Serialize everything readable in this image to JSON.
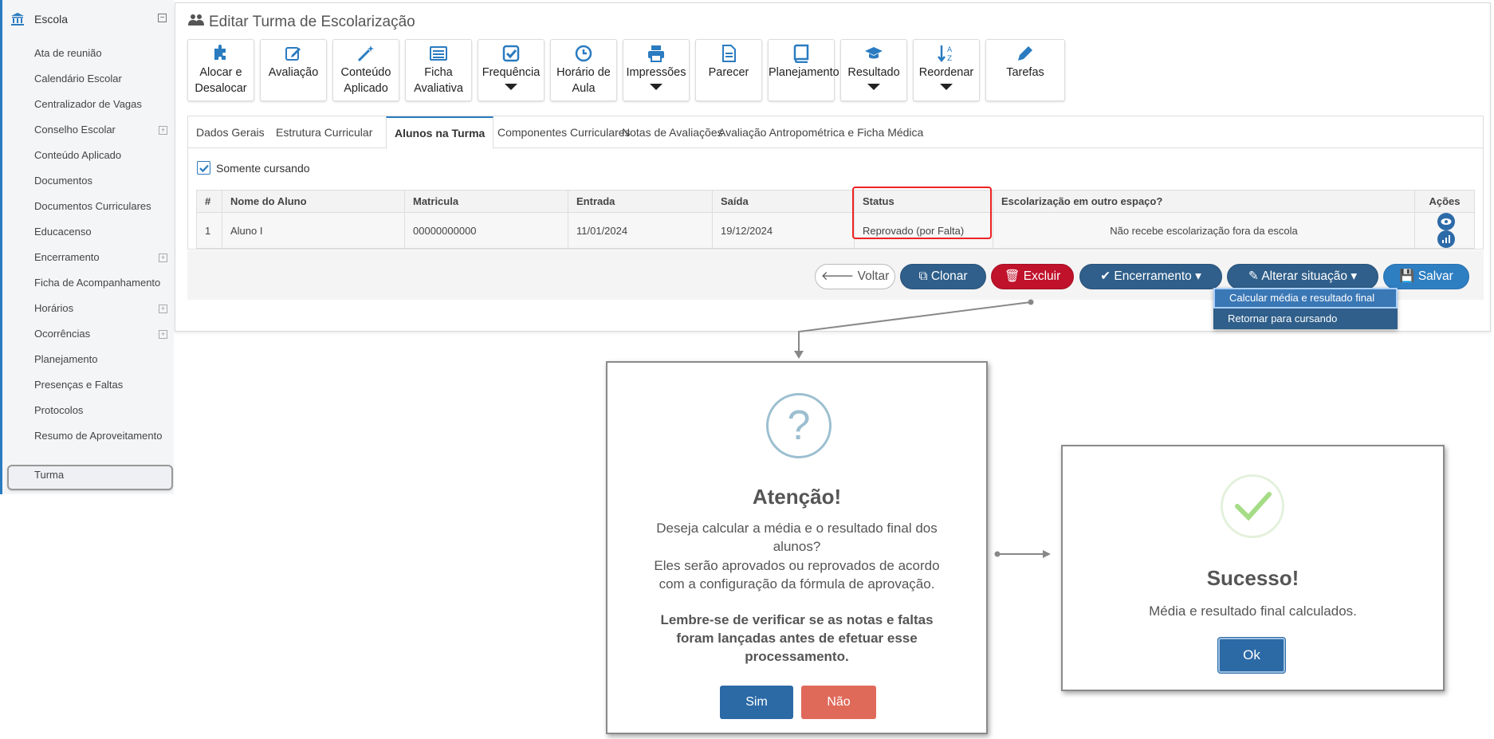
{
  "sidebar": {
    "root_label": "Escola",
    "toggle": "−",
    "items": [
      {
        "label": "Ata de reunião",
        "expandable": false
      },
      {
        "label": "Calendário Escolar",
        "expandable": false
      },
      {
        "label": "Centralizador de Vagas",
        "expandable": false
      },
      {
        "label": "Conselho Escolar",
        "expandable": true
      },
      {
        "label": "Conteúdo Aplicado",
        "expandable": false
      },
      {
        "label": "Documentos",
        "expandable": false
      },
      {
        "label": "Documentos Curriculares",
        "expandable": false
      },
      {
        "label": "Educacenso",
        "expandable": false
      },
      {
        "label": "Encerramento",
        "expandable": true
      },
      {
        "label": "Ficha de Acompanhamento",
        "expandable": false
      },
      {
        "label": "Horários",
        "expandable": true
      },
      {
        "label": "Ocorrências",
        "expandable": true
      },
      {
        "label": "Planejamento",
        "expandable": false
      },
      {
        "label": "Presenças e Faltas",
        "expandable": false
      },
      {
        "label": "Protocolos",
        "expandable": false
      },
      {
        "label": "Resumo de Aproveitamento",
        "expandable": false
      },
      {
        "label": "Turma",
        "expandable": false,
        "active": true
      }
    ],
    "plus": "+"
  },
  "page": {
    "title": "Editar Turma de Escolarização"
  },
  "toolbar": [
    {
      "label": "Alocar e\nDesalocar",
      "icon": "puzzle-icon"
    },
    {
      "label": "Avaliação",
      "icon": "edit-icon"
    },
    {
      "label": "Conteúdo\nAplicado",
      "icon": "magic-wand-icon"
    },
    {
      "label": "Ficha\nAvaliativa",
      "icon": "list-icon"
    },
    {
      "label": "Frequência",
      "icon": "checkbox-icon",
      "caret": true
    },
    {
      "label": "Horário de\nAula",
      "icon": "clock-icon"
    },
    {
      "label": "Impressões",
      "icon": "printer-icon",
      "caret": true
    },
    {
      "label": "Parecer",
      "icon": "document-icon"
    },
    {
      "label": "Planejamento",
      "icon": "book-icon"
    },
    {
      "label": "Resultado",
      "icon": "graduation-cap-icon",
      "caret": true
    },
    {
      "label": "Reordenar",
      "icon": "sort-alpha-icon",
      "caret": true
    },
    {
      "label": "Tarefas",
      "icon": "pencil-icon"
    }
  ],
  "tabs": [
    "Dados Gerais",
    "Estrutura Curricular",
    "Alunos na Turma",
    "Componentes Curriculares",
    "Notas de Avaliações",
    "Avaliação Antropométrica e Ficha Médica"
  ],
  "active_tab": "Alunos na Turma",
  "filter": {
    "label": "Somente cursando",
    "checked": true
  },
  "table": {
    "headers": [
      "#",
      "Nome do Aluno",
      "Matricula",
      "Entrada",
      "Saída",
      "Status",
      "Escolarização em outro espaço?",
      "Ações"
    ],
    "rows": [
      [
        "1",
        "Aluno I",
        "00000000000",
        "11/01/2024",
        "19/12/2024",
        "Reprovado (por Falta)",
        "Não recebe escolarização fora da escola"
      ]
    ]
  },
  "buttons": {
    "voltar": "Voltar",
    "clonar": "Clonar",
    "excluir": "Excluir",
    "encerramento": "Encerramento",
    "alterar": "Alterar situação",
    "salvar": "Salvar"
  },
  "dropdown": {
    "items": [
      "Calcular média e resultado final",
      "Retornar para cursando"
    ]
  },
  "confirm_dialog": {
    "icon_text": "?",
    "title": "Atenção!",
    "text1": "Deseja calcular a média e o resultado final dos alunos?",
    "text2": "Eles serão aprovados ou reprovados de acordo com a configuração da fórmula de aprovação.",
    "text3": "Lembre-se de verificar se as notas e faltas foram lançadas antes de efetuar esse processamento.",
    "yes": "Sim",
    "no": "Não"
  },
  "success_dialog": {
    "title": "Sucesso!",
    "text": "Média e resultado final calculados.",
    "ok": "Ok"
  },
  "colors": {
    "primary": "#2a7bc0",
    "dark_button": "#2f5f8a",
    "danger": "#c0122b",
    "highlight": "#e22222",
    "sim": "#2c6aa6",
    "nao": "#e06a5a",
    "success": "#a5dc86",
    "question": "#9cbfd0"
  }
}
